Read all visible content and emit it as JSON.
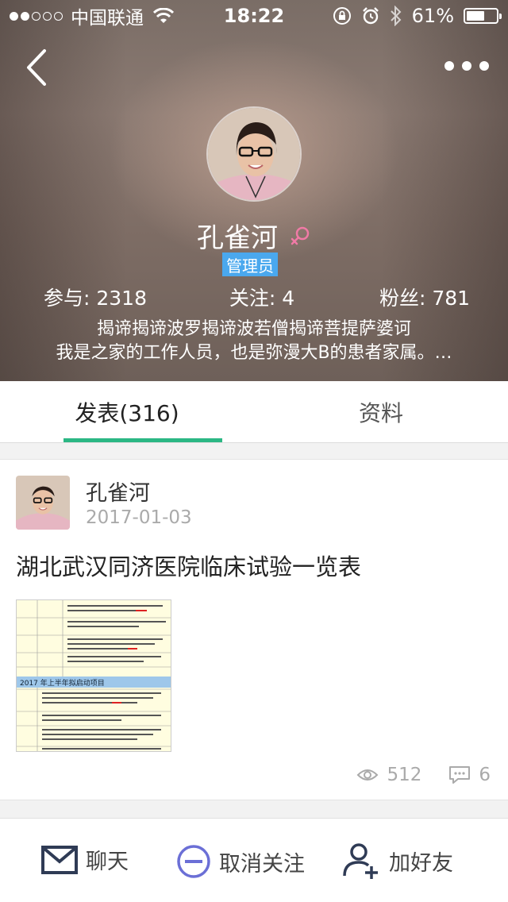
{
  "status_bar": {
    "carrier": "中国联通",
    "time": "18:22",
    "battery": "61%",
    "battery_level": 0.61
  },
  "profile": {
    "name": "孔雀河",
    "role": "管理员",
    "stats": [
      {
        "label": "参与: 2318"
      },
      {
        "label": "关注: 4"
      },
      {
        "label": "粉丝: 781"
      }
    ],
    "bio_line1": "揭谛揭谛波罗揭谛波若僧揭谛菩提萨婆诃",
    "bio_line2": "我是之家的工作人员，也是弥漫大B的患者家属。…"
  },
  "tabs": [
    {
      "label": "发表(316)",
      "active": true
    },
    {
      "label": "资料",
      "active": false
    }
  ],
  "post": {
    "author": "孔雀河",
    "date": "2017-01-03",
    "title": "湖北武汉同济医院临床试验一览表",
    "thumbnail_banner": "2017 年上半年拟启动项目",
    "views": "512",
    "comments": "6"
  },
  "bottom_bar": {
    "chat": "聊天",
    "unfollow": "取消关注",
    "add_friend": "加好友"
  },
  "colors": {
    "accent_green": "#2bb784",
    "role_blue": "#4aa8ee",
    "unfollow_purple": "#6b6fd6"
  }
}
